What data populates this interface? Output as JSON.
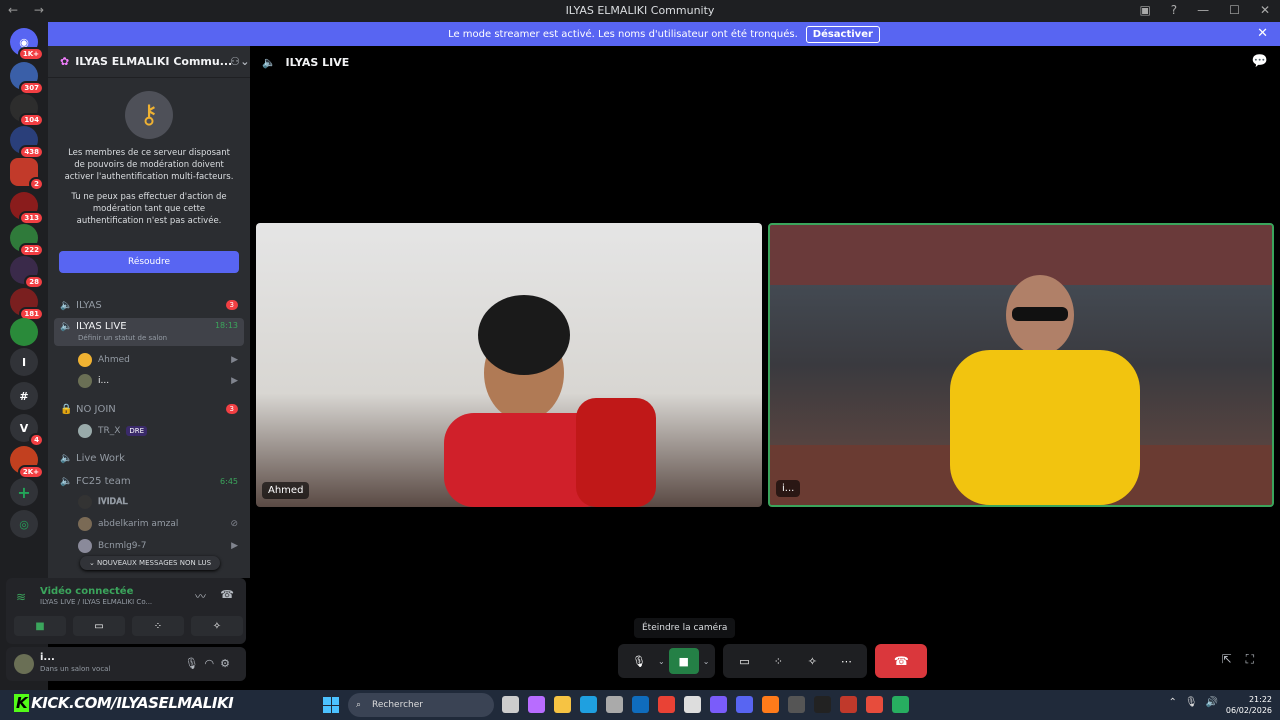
{
  "window": {
    "title": "ILYAS ELMALIKI Community"
  },
  "streamer_banner": {
    "text": "Le mode streamer est activé. Les noms d'utilisateur ont été tronqués.",
    "button": "Désactiver"
  },
  "servers": [
    {
      "icon": "discord-logo-icon",
      "badge": "1K+",
      "color": "#5865f2"
    },
    {
      "badge": "307",
      "color": "#3a5fa8"
    },
    {
      "badge": "104",
      "color": "#2d2d2d"
    },
    {
      "badge": "438",
      "color": "#2a3f7a"
    },
    {
      "badge": "2",
      "color": "#c23a2a"
    },
    {
      "badge": "313",
      "color": "#8a1c1c"
    },
    {
      "badge": "222",
      "color": "#2f7a3a"
    },
    {
      "badge": "28",
      "color": "#3a2a4a"
    },
    {
      "badge": "181",
      "color": "#7a1f1f"
    },
    {
      "badge": "",
      "color": "#2a8a3a"
    },
    {
      "label": "I",
      "badge": "",
      "color": "#313338"
    },
    {
      "label": "#",
      "badge": "",
      "color": "#313338"
    },
    {
      "label": "V",
      "badge": "4",
      "color": "#313338"
    },
    {
      "badge": "2K+",
      "color": "#c2401f"
    }
  ],
  "sidebar": {
    "server_name": "ILYAS ELMALIKI Commu...",
    "mfa": {
      "text1": "Les membres de ce serveur disposant de pouvoirs de modération doivent activer l'authentification multi-facteurs.",
      "text2": "Tu ne peux pas effectuer d'action de modération tant que cette authentification n'est pas activée.",
      "button": "Résoudre"
    },
    "channels": {
      "ilyas": {
        "name": "ILYAS",
        "count": "3"
      },
      "ilyas_live": {
        "name": "ILYAS LIVE",
        "time": "18:13",
        "status": "Définir un statut de salon"
      },
      "no_join": {
        "name": "NO JOIN",
        "count": "3"
      },
      "live_work": {
        "name": "Live Work"
      },
      "fc25": {
        "name": "FC25 team",
        "time": "6:45"
      }
    },
    "members": {
      "ahmed": "Ahmed",
      "i": "i...",
      "trx": "TR_X",
      "trx_tag": "DRE",
      "vidal": "𝐈𝐕𝐈𝐃𝐀𝐋",
      "abdelkarim": "abdelkarim amzal",
      "bcnmlg": "Bcnmlg9-7"
    },
    "new_messages": "NOUVEAUX MESSAGES NON LUS",
    "voice": {
      "status": "Vidéo connectée",
      "location": "ILYAS LIVE / ILYAS ELMALIKI Co..."
    },
    "user": {
      "name": "i...",
      "status": "Dans un salon vocal"
    }
  },
  "stage": {
    "channel": "ILYAS LIVE",
    "tiles": [
      {
        "name": "Ahmed"
      },
      {
        "name": "i..."
      }
    ],
    "tooltip": "Éteindre la caméra"
  },
  "taskbar": {
    "brand_k": "K",
    "brand": "KICK.COM/ILYASELMALIKI",
    "search": "Rechercher",
    "time": "21:22",
    "date": "06/02/2026"
  },
  "colors": {
    "accent": "#5865f2",
    "online": "#3ba55c",
    "danger": "#da373c"
  }
}
